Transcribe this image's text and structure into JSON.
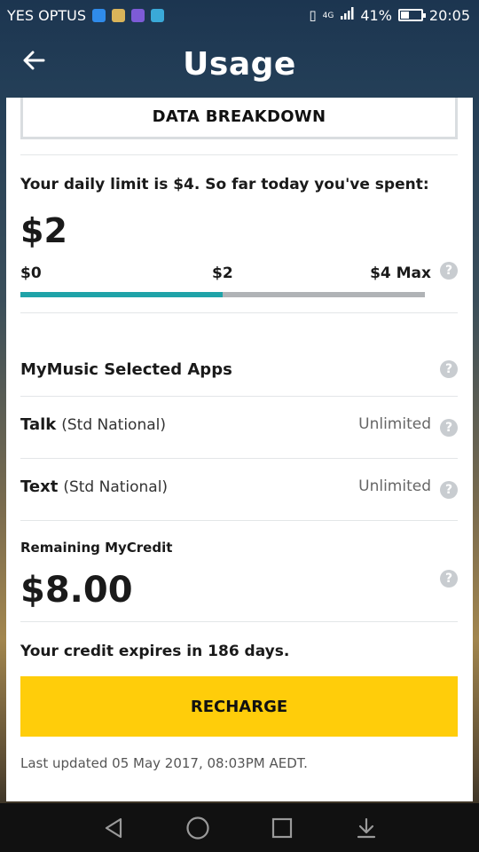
{
  "status_bar": {
    "carrier": "YES OPTUS",
    "network": "4G",
    "battery": "41%",
    "battery_level": 0.41,
    "time": "20:05",
    "notification_icons": [
      "message-icon",
      "notes-icon",
      "gallery-icon",
      "play-store-icon"
    ]
  },
  "header": {
    "title": "Usage",
    "back_icon": "arrow-left-icon"
  },
  "breakdown_button": {
    "label": "DATA BREAKDOWN"
  },
  "daily_limit": {
    "text": "Your daily limit is $4. So far today you've spent:",
    "spent": "$2",
    "scale_min": "$0",
    "scale_mid": "$2",
    "scale_max": "$4 Max",
    "progress": 0.5
  },
  "rows": [
    {
      "label": "MyMusic Selected Apps",
      "sub": "",
      "value": ""
    },
    {
      "label": "Talk",
      "sub": "(Std National)",
      "value": "Unlimited"
    },
    {
      "label": "Text",
      "sub": "(Std National)",
      "value": "Unlimited"
    }
  ],
  "credit": {
    "label": "Remaining MyCredit",
    "amount": "$8.00",
    "expires": "Your credit expires in 186 days."
  },
  "recharge_button": {
    "label": "RECHARGE"
  },
  "last_updated": "Last updated 05 May 2017, 08:03PM AEDT.",
  "colors": {
    "accent": "#ffcd0a",
    "progress": "#1fa3a8",
    "track": "#b0b3b6"
  },
  "nav": [
    "back-triangle-icon",
    "home-circle-icon",
    "recents-square-icon",
    "notification-pull-icon"
  ]
}
